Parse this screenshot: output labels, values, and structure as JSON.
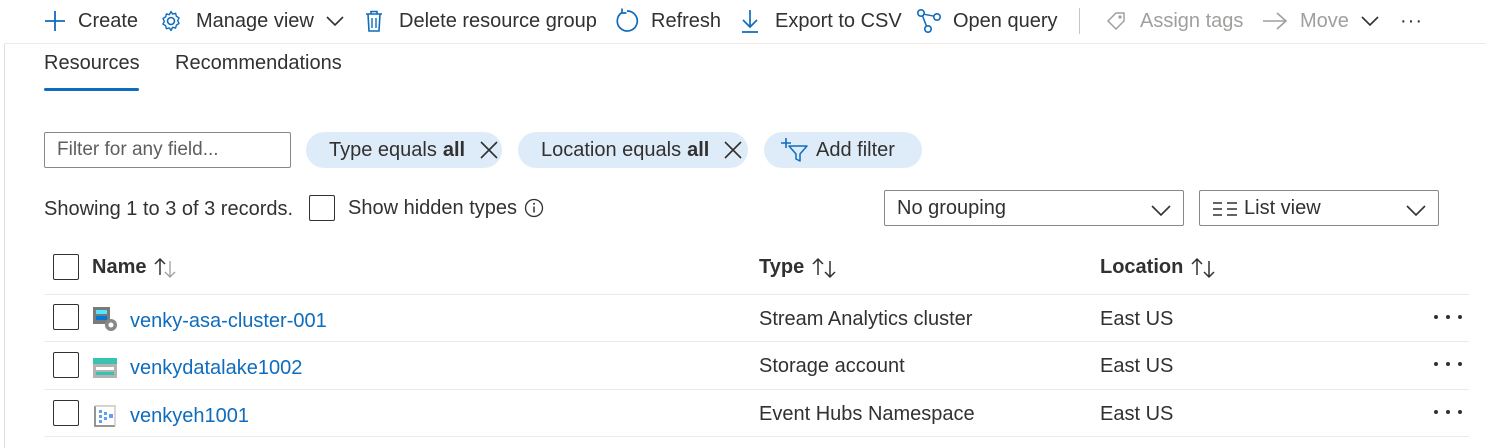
{
  "toolbar": {
    "create": "Create",
    "manage_view": "Manage view",
    "delete_rg": "Delete resource group",
    "refresh": "Refresh",
    "export_csv": "Export to CSV",
    "open_query": "Open query",
    "assign_tags": "Assign tags",
    "move": "Move",
    "more": "···"
  },
  "tabs": [
    "Resources",
    "Recommendations"
  ],
  "active_tab": "Resources",
  "filter": {
    "placeholder": "Filter for any field...",
    "pills": [
      {
        "label": "Type equals",
        "value": "all"
      },
      {
        "label": "Location equals",
        "value": "all"
      }
    ],
    "add_filter": "Add filter"
  },
  "summary": {
    "showing": "Showing 1 to 3 of 3 records.",
    "show_hidden_types": "Show hidden types",
    "grouping": "No grouping",
    "view": "List view"
  },
  "table": {
    "columns": [
      "Name",
      "Type",
      "Location"
    ],
    "rows": [
      {
        "name": "venky-asa-cluster-001",
        "type": "Stream Analytics cluster",
        "location": "East US",
        "icon": "stream-analytics-icon"
      },
      {
        "name": "venkydatalake1002",
        "type": "Storage account",
        "location": "East US",
        "icon": "storage-account-icon"
      },
      {
        "name": "venkyeh1001",
        "type": "Event Hubs Namespace",
        "location": "East US",
        "icon": "event-hubs-icon"
      }
    ]
  },
  "colors": {
    "accent": "#0f6cbd",
    "pill_bg": "#deecf9",
    "text": "#323130",
    "disabled": "#a19f9d"
  }
}
